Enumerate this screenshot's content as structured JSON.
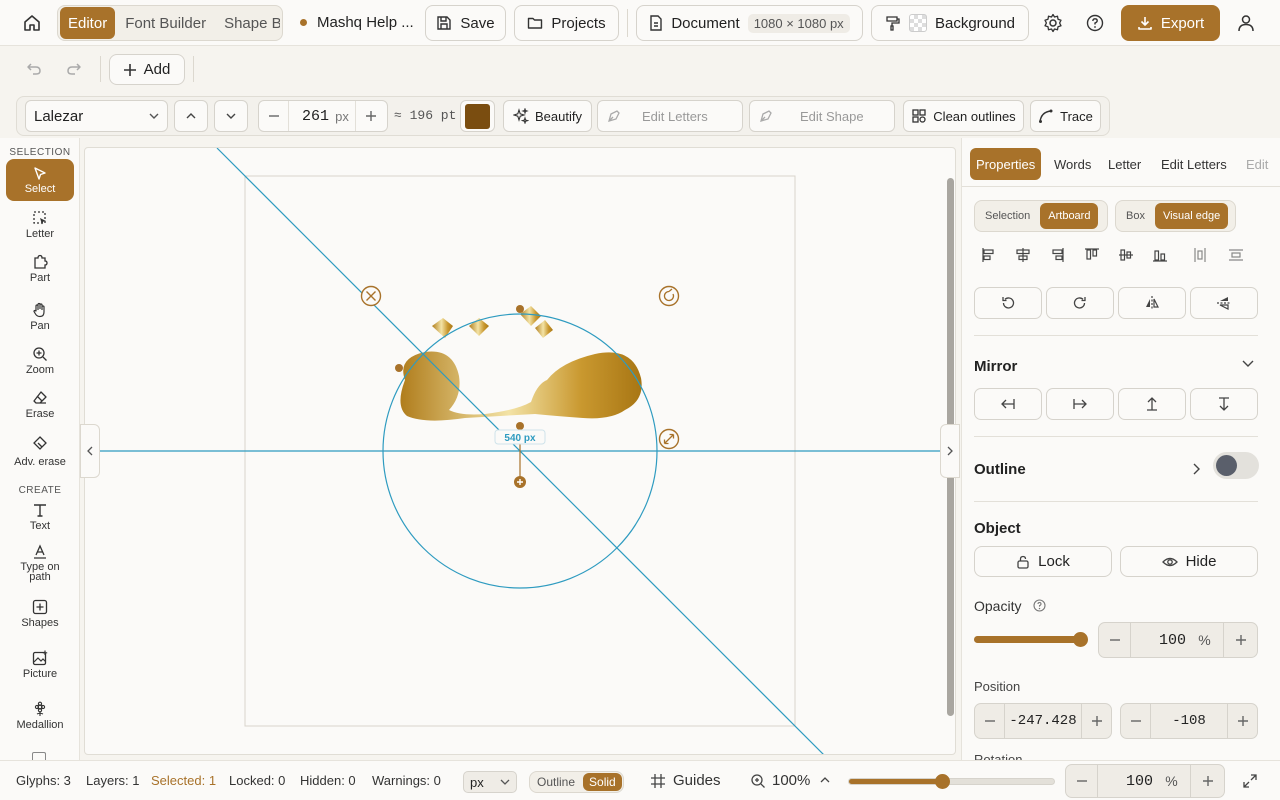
{
  "topbar": {
    "modes": [
      "Editor",
      "Font Builder",
      "Shape Builder"
    ],
    "active_mode": "Editor",
    "doc_name": "Mashq Help ...",
    "save_label": "Save",
    "projects_label": "Projects",
    "document_label": "Document",
    "document_size": "1080 × 1080 px",
    "background_label": "Background",
    "export_label": "Export"
  },
  "row2": {
    "add_label": "Add"
  },
  "toolbar": {
    "font_name": "Lalezar",
    "font_size": "261",
    "font_unit": "px",
    "pt_equiv": "≈ 196 pt",
    "swatch_color": "#7a4d10",
    "beautify": "Beautify",
    "edit_letters": "Edit Letters",
    "edit_shape": "Edit Shape",
    "clean_outlines": "Clean outlines",
    "trace": "Trace"
  },
  "leftbar": {
    "selection_heading": "SELECTION",
    "create_heading": "CREATE",
    "tools": {
      "select": "Select",
      "letter": "Letter",
      "part": "Part",
      "pan": "Pan",
      "zoom": "Zoom",
      "erase": "Erase",
      "adv_erase": "Adv. erase",
      "text": "Text",
      "type_on_path": "Type on path",
      "shapes": "Shapes",
      "picture": "Picture",
      "medallion": "Medallion"
    }
  },
  "canvas": {
    "measure_label": "540 px",
    "artwork_text": "مشق"
  },
  "rightpanel": {
    "tabs": [
      "Properties",
      "Words",
      "Letter",
      "Edit Letters",
      "Edit"
    ],
    "active_tab": "Properties",
    "align_to": [
      "Selection",
      "Artboard"
    ],
    "align_to_active": "Artboard",
    "edge_mode": [
      "Box",
      "Visual edge"
    ],
    "edge_mode_active": "Visual edge",
    "mirror_heading": "Mirror",
    "outline_heading": "Outline",
    "object_heading": "Object",
    "lock_label": "Lock",
    "hide_label": "Hide",
    "opacity_label": "Opacity",
    "opacity_value": "100",
    "opacity_unit": "%",
    "opacity_level": 1.0,
    "position_label": "Position",
    "pos_x": "-247.428",
    "pos_y": "-108",
    "rotation_label": "Rotation"
  },
  "statusbar": {
    "glyphs": "Glyphs: 3",
    "layers": "Layers: 1",
    "selected": "Selected: 1",
    "locked": "Locked: 0",
    "hidden": "Hidden: 0",
    "warnings": "Warnings: 0",
    "unit": "px",
    "view_modes": [
      "Outline",
      "Solid"
    ],
    "view_active": "Solid",
    "guides": "Guides",
    "zoom": "100%",
    "zoom_value": "100",
    "zoom_unit": "%",
    "zoom_level": 0.45
  },
  "colors": {
    "accent": "#a8722a",
    "guide": "#2e9bc0"
  }
}
